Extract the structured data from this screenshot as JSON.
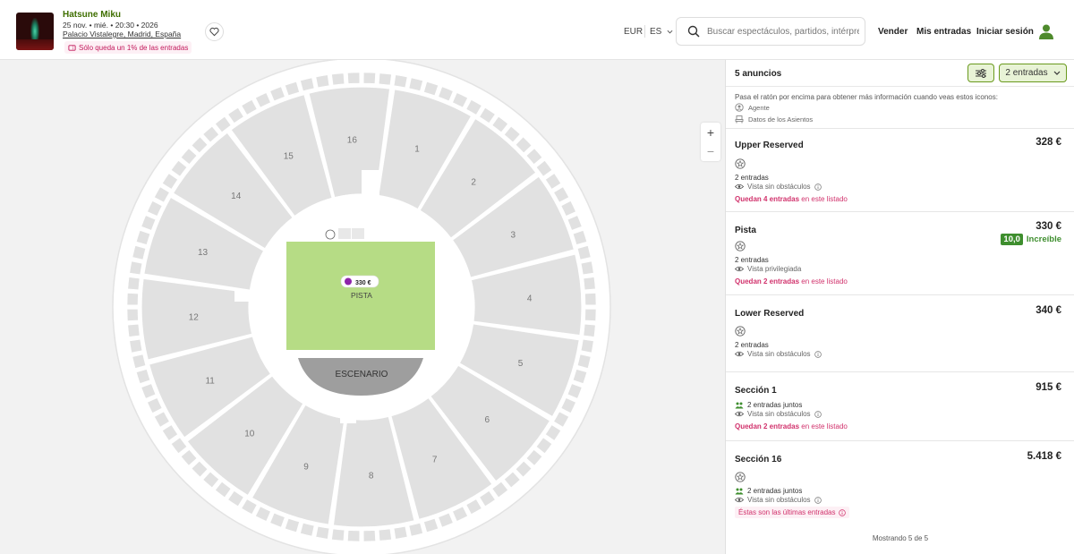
{
  "event": {
    "title": "Hatsune Miku",
    "date": "25 nov. • mié. • 20:30 • 2026",
    "venue": "Palacio Vistalegre, Madrid, España",
    "badge": "Sólo queda un 1% de las entradas"
  },
  "header": {
    "currency": "EUR",
    "language": "ES",
    "search_placeholder": "Buscar espectáculos, partidos, intérpretes",
    "nav": {
      "sell": "Vender",
      "my_tickets": "Mis entradas",
      "login": "Iniciar sesión"
    }
  },
  "map": {
    "stage_label": "ESCENARIO",
    "floor_label": "PISTA",
    "floor_price": "330 €",
    "sections": [
      "1",
      "2",
      "3",
      "4",
      "5",
      "6",
      "7",
      "8",
      "9",
      "10",
      "11",
      "12",
      "13",
      "14",
      "15",
      "16"
    ],
    "colors": {
      "floor": "#b6dc85",
      "sections": "#e1e1e1",
      "stage": "#9e9e9e"
    }
  },
  "panel": {
    "count": "5 anuncios",
    "quantity": "2 entradas",
    "hint": "Pasa el ratón por encima para obtener más información cuando veas estos iconos:",
    "legend": [
      {
        "icon": "agent-icon",
        "label": "Agente"
      },
      {
        "icon": "seat-icon",
        "label": "Datos de los Asientos"
      }
    ],
    "listings": [
      {
        "name": "Upper Reserved",
        "price": "328 €",
        "qty": "2 entradas",
        "view": "Vista sin obstáculos",
        "left_bold": "Quedan 4 entradas",
        "left_rest": " en este listado"
      },
      {
        "name": "Pista",
        "price": "330 €",
        "score": "10,0",
        "score_label": "Increíble",
        "qty": "2 entradas",
        "view": "Vista privilegiada",
        "left_bold": "Quedan 2 entradas",
        "left_rest": " en este listado"
      },
      {
        "name": "Lower Reserved",
        "price": "340 €",
        "qty": "2 entradas",
        "view": "Vista sin obstáculos"
      },
      {
        "name": "Sección 1",
        "price": "915 €",
        "qty": "2 entradas juntos",
        "view": "Vista sin obstáculos",
        "left_bold": "Quedan 2 entradas",
        "left_rest": " en este listado"
      },
      {
        "name": "Sección 16",
        "price": "5.418 €",
        "qty": "2 entradas juntos",
        "view": "Vista sin obstáculos",
        "last": "Éstas son las últimas entradas"
      }
    ],
    "showing": "Mostrando 5 de 5"
  }
}
